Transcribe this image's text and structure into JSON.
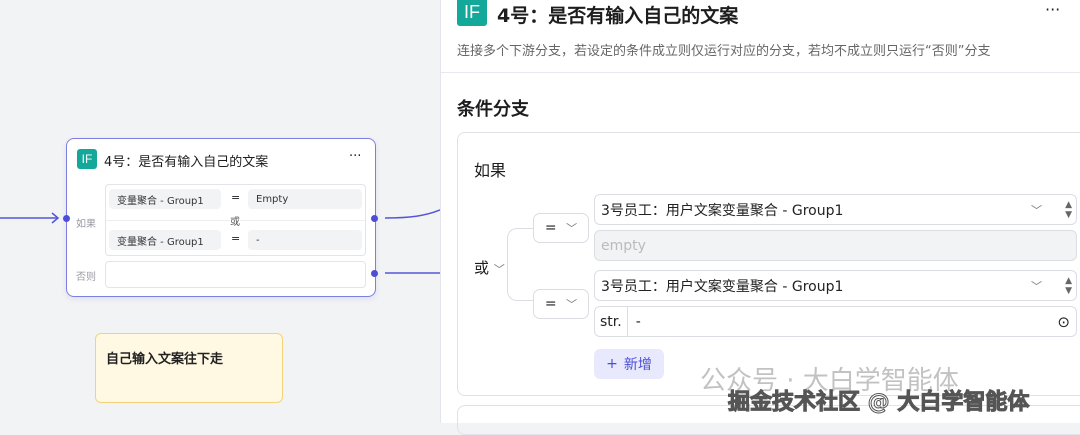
{
  "node": {
    "icon": "IF",
    "title": "4号：是否有输入自己的文案",
    "menu": "···",
    "if_label": "如果",
    "else_label": "否则",
    "or_label": "或",
    "conditions": [
      {
        "left": "变量聚合 - Group1",
        "op": "=",
        "right": "Empty"
      },
      {
        "left": "变量聚合 - Group1",
        "op": "=",
        "right": "-"
      }
    ]
  },
  "note": {
    "text": "自己输入文案往下走"
  },
  "panel": {
    "icon": "IF",
    "title": "4号：是否有输入自己的文案",
    "menu": "···",
    "description": "连接多个下游分支，若设定的条件成立则仅运行对应的分支，若均不成立则只运行“否则”分支",
    "section_title": "条件分支",
    "if_label": "如果",
    "logic": "或",
    "conditions": [
      {
        "op": "=",
        "variable": "3号员工：用户文案变量聚合 - Group1",
        "value_placeholder": "empty"
      },
      {
        "op": "=",
        "variable": "3号员工：用户文案变量聚合 - Group1",
        "value_type": "str.",
        "value": "-"
      }
    ],
    "add_label": "新增"
  },
  "watermark": {
    "line1": "公众号 · 大白学智能体",
    "line2": "掘金技术社区 @ 大白学智能体"
  }
}
